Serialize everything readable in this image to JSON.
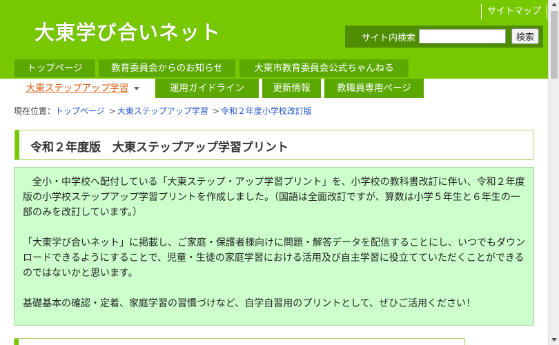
{
  "header": {
    "logo": "大東学び合いネット",
    "sitemap": "サイトマップ",
    "search_label": "サイト内検索",
    "search_value": "",
    "search_button": "検索"
  },
  "nav": {
    "row1": [
      "トップページ",
      "教育委員会からのお知らせ",
      "大東市教育委員会公式ちゃんねる"
    ],
    "row2": [
      "大東ステップアップ学習",
      "運用ガイドライン",
      "更新情報",
      "教職員専用ページ"
    ],
    "active": "大東ステップアップ学習"
  },
  "breadcrumb": {
    "label": "現在位置：",
    "items": [
      "トップページ",
      "大東ステップアップ学習",
      "令和２年度小学校改訂版"
    ],
    "separator": ">"
  },
  "title": "令和２年度版　大東ステップアップ学習プリント",
  "content": {
    "paragraphs": [
      "　全小・中学校へ配付している「大東ステップ・アップ学習プリント」を、小学校の教科書改訂に伴い、令和２年度版の小学校ステップアップ学習プリントを作成しました。（国語は全面改訂ですが、算数は小学５年生と６年生の一部のみを改訂しています。）",
      "「大東学び合いネット」に掲載し、ご家庭・保護者様向けに問題・解答データを配信することにし、いつでもダウンロードできるようにすることで、児童・生徒の家庭学習における活用及び自主学習に役立てていただくことができるのではないかと思います。",
      "基礎基本の確認・定着、家庭学習の習慣づけなど、自学自習用のプリントとして、ぜひご活用ください！"
    ]
  },
  "colors": {
    "header_green": "#78c800",
    "tab_green": "#5aa800",
    "content_bg": "#ccffcc",
    "active_tab_text": "#e05a10",
    "link": "#2255cc"
  }
}
